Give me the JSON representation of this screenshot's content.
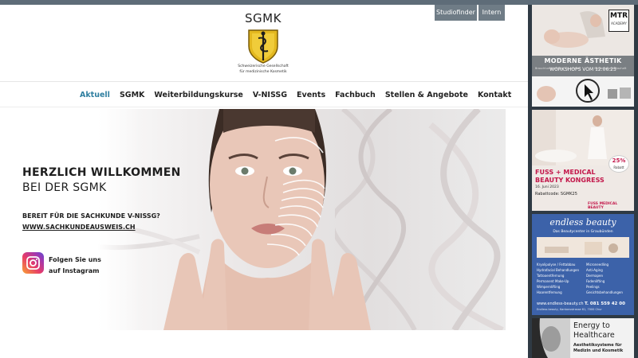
{
  "utility": {
    "studiofinder": "Studiofinder",
    "intern": "Intern"
  },
  "brand": {
    "title": "SGMK",
    "subtitle_line1": "Schweizerische Gesellschaft",
    "subtitle_line2": "für medizinische Kosmetik"
  },
  "nav": [
    "Aktuell",
    "SGMK",
    "Weiterbildungskurse",
    "V-NISSG",
    "Events",
    "Fachbuch",
    "Stellen & Angebote",
    "Kontakt"
  ],
  "hero": {
    "title": "HERZLICH WILLKOMMEN",
    "subtitle": "BEI DER SGMK",
    "question": "BEREIT FÜR DIE SACHKUNDE V-NISSG?",
    "link": "WWW.SACHKUNDEAUSWEIS.CH",
    "instagram_line1": "Folgen Sie uns",
    "instagram_line2": "auf Instagram"
  },
  "ads": {
    "ad1": {
      "logo": "MTR",
      "logo_sub": "ACADEMY",
      "title": "MODERNE ÄSTHETIK",
      "sub": "WORKSHOPS VOM 12.06.23",
      "small_left": "Brauchtumkunst aus Kauzendorf",
      "small_right": "Wiedergebewerbschaft"
    },
    "ad2": {
      "badge_pct": "25%",
      "badge_label": "Rabatt",
      "title_line1": "FUSS + MEDICAL",
      "title_line2": "BEAUTY KONGRESS",
      "date": "16. Juni 2023",
      "code": "Rabattcode: SGMK25",
      "footer_logo": "FUSS MEDICAL BEAUTY"
    },
    "ad3": {
      "brand": "endless beauty",
      "tagline": "Das Beautycenter in Graubünden",
      "left_items": [
        "Kryolipolyse / Fettabbau",
        "Hydrafacial Behandlungen",
        "Tattooentfernung",
        "Permanent Make-Up",
        "Wimpernlifting",
        "Haarentfernung"
      ],
      "right_items": [
        "Microneedling",
        "Anti-Aging",
        "Dermapen",
        "Fadenlifting",
        "Peelings",
        "Gesichtsbehandlungen"
      ],
      "phone": "T. 081 559 42 00",
      "web": "www.endless-beauty.ch",
      "address": "Endless beauty, Kantonsstrasse 61, 7000 Chur"
    },
    "ad4": {
      "title_line1": "Energy to",
      "title_line2": "Healthcare",
      "sub_line1": "Aesthetiksysteme für",
      "sub_line2": "Medizin und Kosmetik"
    }
  },
  "colors": {
    "accent": "#2f7fa0",
    "topbar": "#5e6c78",
    "sidebar": "#2f3a44",
    "ad2_accent": "#c3174a",
    "ad3_bg": "#3c62a9"
  }
}
